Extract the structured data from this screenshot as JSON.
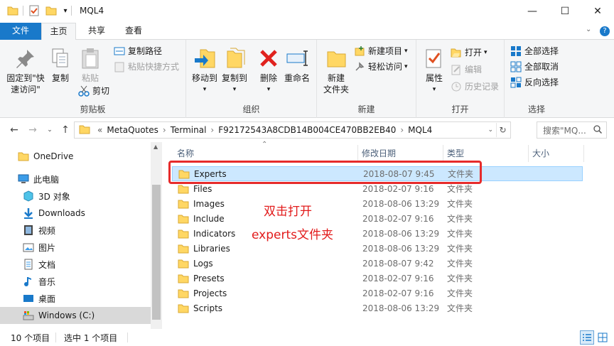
{
  "window": {
    "title": "MQL4",
    "minimize": "—",
    "maximize": "☐",
    "close": "✕"
  },
  "tabs": {
    "file": "文件",
    "home": "主页",
    "share": "共享",
    "view": "查看"
  },
  "ribbon": {
    "clipboard": {
      "label": "剪贴板",
      "pin": "固定到\"快\n速访问\"",
      "copy": "复制",
      "paste": "粘贴",
      "copy_path": "复制路径",
      "paste_shortcut": "粘贴快捷方式",
      "cut": "剪切"
    },
    "organize": {
      "label": "组织",
      "move_to": "移动到",
      "copy_to": "复制到",
      "delete": "删除",
      "rename": "重命名"
    },
    "new": {
      "label": "新建",
      "new_folder": "新建\n文件夹",
      "new_item": "新建项目",
      "easy_access": "轻松访问"
    },
    "open": {
      "label": "打开",
      "properties": "属性",
      "open": "打开",
      "edit": "编辑",
      "history": "历史记录"
    },
    "select": {
      "label": "选择",
      "select_all": "全部选择",
      "select_none": "全部取消",
      "invert": "反向选择"
    }
  },
  "address": {
    "prefix": "«",
    "crumbs": [
      "MetaQuotes",
      "Terminal",
      "F92172543A8CDB14B004CE470BB2EB40",
      "MQL4"
    ],
    "search_placeholder": "搜索\"MQ..."
  },
  "nav": {
    "items": [
      "OneDrive",
      "此电脑",
      "3D 对象",
      "Downloads",
      "视频",
      "图片",
      "文档",
      "音乐",
      "桌面",
      "Windows (C:)"
    ]
  },
  "columns": {
    "name": "名称",
    "date": "修改日期",
    "type": "类型",
    "size": "大小"
  },
  "files": [
    {
      "name": "Experts",
      "date": "2018-08-07 9:45",
      "type": "文件夹"
    },
    {
      "name": "Files",
      "date": "2018-02-07 9:16",
      "type": "文件夹"
    },
    {
      "name": "Images",
      "date": "2018-08-06 13:29",
      "type": "文件夹"
    },
    {
      "name": "Include",
      "date": "2018-02-07 9:16",
      "type": "文件夹"
    },
    {
      "name": "Indicators",
      "date": "2018-08-06 13:29",
      "type": "文件夹"
    },
    {
      "name": "Libraries",
      "date": "2018-08-06 13:29",
      "type": "文件夹"
    },
    {
      "name": "Logs",
      "date": "2018-08-07 9:42",
      "type": "文件夹"
    },
    {
      "name": "Presets",
      "date": "2018-02-07 9:16",
      "type": "文件夹"
    },
    {
      "name": "Projects",
      "date": "2018-02-07 9:16",
      "type": "文件夹"
    },
    {
      "name": "Scripts",
      "date": "2018-08-06 13:29",
      "type": "文件夹"
    }
  ],
  "annotation": {
    "line1": "双击打开",
    "line2": "experts文件夹"
  },
  "status": {
    "count": "10 个项目",
    "selected": "选中 1 个项目"
  },
  "colors": {
    "accent": "#1979ca",
    "selection": "#cce8ff",
    "annotation": "#e21b1b",
    "folder": "#ffd764"
  }
}
